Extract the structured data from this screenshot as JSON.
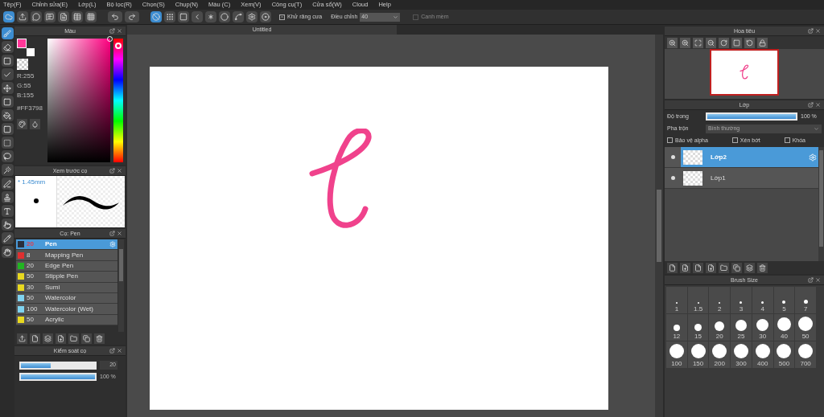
{
  "menu": [
    "Tệp(F)",
    "Chỉnh sửa(E)",
    "Lớp(L)",
    "Bộ lọc(R)",
    "Chọn(S)",
    "Chụp(N)",
    "Màu (C)",
    "Xem(V)",
    "Công cụ(T)",
    "Cửa sổ(W)",
    "Cloud",
    "Help"
  ],
  "toolbar": {
    "mode_buttons": [
      {
        "selected": true
      },
      {
        "selected": false
      },
      {
        "selected": false
      },
      {
        "selected": false
      },
      {
        "selected": false
      },
      {
        "selected": false
      },
      {
        "selected": false
      },
      {
        "selected": false
      },
      {
        "selected": false
      }
    ],
    "antialias": {
      "label": "Khử răng cưa",
      "checked": true
    },
    "correction": {
      "label": "Điều chỉnh",
      "value": "40"
    },
    "soft_edge": {
      "label": "Canh mềm",
      "checked": false,
      "disabled": true
    }
  },
  "tools": [
    {
      "selected": true
    },
    {
      "selected": false
    },
    {
      "selected": false
    },
    {
      "selected": false
    },
    {
      "selected": false
    },
    {
      "selected": false
    },
    {
      "selected": false
    },
    {
      "selected": false
    },
    {
      "selected": false
    },
    {
      "selected": false
    },
    {
      "selected": false
    },
    {
      "selected": false
    },
    {
      "selected": false
    },
    {
      "selected": false
    },
    {
      "selected": false
    },
    {
      "selected": false
    },
    {
      "selected": false
    }
  ],
  "color_panel": {
    "title": "Màu",
    "r": "R:255",
    "g": "G:55",
    "b": "B:155",
    "hex": "#FF3798",
    "color": "#ff3798",
    "hue": {
      "level": 0.06
    }
  },
  "brush_preview": {
    "title": "Xem trước cọ",
    "size": "* 1.45mm"
  },
  "brush_panel": {
    "title": "Cọ: Pen",
    "brushes": [
      {
        "size": "20",
        "name": "Pen",
        "color": "#2a2f3a",
        "selected": true
      },
      {
        "size": "8",
        "name": "Mapping Pen",
        "color": "#e03030",
        "selected": false
      },
      {
        "size": "20",
        "name": "Edge Pen",
        "color": "#22b522",
        "selected": false
      },
      {
        "size": "50",
        "name": "Stipple Pen",
        "color": "#e8d820",
        "selected": false
      },
      {
        "size": "30",
        "name": "Sumi",
        "color": "#e8d820",
        "selected": false
      },
      {
        "size": "50",
        "name": "Watercolor",
        "color": "#7fd3f0",
        "selected": false
      },
      {
        "size": "100",
        "name": "Watercolor (Wet)",
        "color": "#7fd3f0",
        "selected": false
      },
      {
        "size": "50",
        "name": "Acrylic",
        "color": "#e8d820",
        "selected": false
      }
    ]
  },
  "brush_control": {
    "title": "Kiểm soát cọ",
    "size": {
      "level": 0.4,
      "reading": "20"
    },
    "opacity": {
      "level": 1,
      "reading": "100 %"
    }
  },
  "canvas": {
    "title": "Untitled"
  },
  "navigator": {
    "title": "Hoa tiêu"
  },
  "layers": {
    "title": "Lớp",
    "opacity_label": "Độ trong",
    "opacity": {
      "level": 1,
      "reading": "100 %"
    },
    "blend_label": "Pha trộn",
    "blend": "Bình thường",
    "options": [
      {
        "label": "Bảo vệ alpha",
        "checked": false
      },
      {
        "label": "Xén bớt",
        "checked": false
      },
      {
        "label": "Khóa",
        "checked": false
      }
    ],
    "items": [
      {
        "name": "Lớp2",
        "selected": true,
        "visible": true
      },
      {
        "name": "Lớp1",
        "selected": false,
        "visible": true
      }
    ]
  },
  "brush_size": {
    "title": "Brush Size",
    "sizes": [
      "1",
      "1.5",
      "2",
      "3",
      "4",
      "5",
      "7",
      "12",
      "15",
      "20",
      "25",
      "30",
      "40",
      "50",
      "100",
      "150",
      "200",
      "300",
      "400",
      "500",
      "700"
    ]
  }
}
